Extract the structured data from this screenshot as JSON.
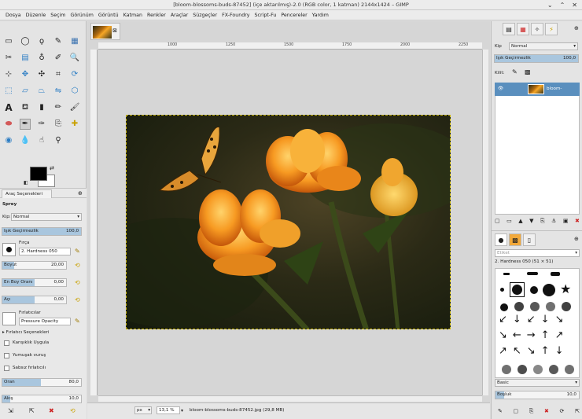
{
  "window": {
    "title": "[bloom-blossoms-buds-87452] (içe aktarılmış)-2.0 (RGB color, 1 katman) 2144x1424 – GIMP"
  },
  "menu": [
    "Dosya",
    "Düzenle",
    "Seçim",
    "Görünüm",
    "Görüntü",
    "Katman",
    "Renkler",
    "Araçlar",
    "Süzgeçler",
    "FX-Foundry",
    "Script-Fu",
    "Pencereler",
    "Yardım"
  ],
  "tool_options": {
    "tab_label": "Araç Seçenekleri",
    "section": "Sprey",
    "mode_label": "Kip:",
    "mode_value": "Normal",
    "opacity_label": "Işık Geçirmezlik",
    "opacity_value": "100,0",
    "brush_label": "Fırça",
    "brush_value": "2. Hardness 050",
    "size_label": "Boyut",
    "size_value": "20,00",
    "aspect_label": "En Boy Oranı",
    "aspect_value": "0,00",
    "angle_label": "Açı",
    "angle_value": "0,00",
    "dynamics_label": "Fırlatıcılar",
    "dynamics_value": "Pressure Opacity",
    "dynamics_options_label": "Fırlatıcı Seçenekleri",
    "jitter_label": "Karışıklık Uygula",
    "smooth_label": "Yumuşak vuruş",
    "incremental_label": "Sabsız fırlatıcılı",
    "rate_label": "Oran",
    "rate_value": "80,0",
    "flow_label": "Akış",
    "flow_value": "10,0"
  },
  "ruler_ticks": [
    "1000",
    "1250",
    "1500",
    "1750",
    "2000",
    "2250"
  ],
  "status": {
    "unit": "px",
    "zoom": "13,1 %",
    "file_info": "bloom-blossoms-buds-87452.jpg (29,8 MB)"
  },
  "layers": {
    "mode_label": "Kip",
    "mode_value": "Normal",
    "opacity_label": "Işık Geçirmezlik",
    "opacity_value": "100,0",
    "lock_label": "Kilit:",
    "layer_name": "bloom-blossom"
  },
  "brushes": {
    "filter_placeholder": "Etiket",
    "brush_name": "2. Hardness 050 (51 × 51)",
    "set_value": "Basic",
    "spacing_label": "Boşluk",
    "spacing_value": "10,0"
  }
}
